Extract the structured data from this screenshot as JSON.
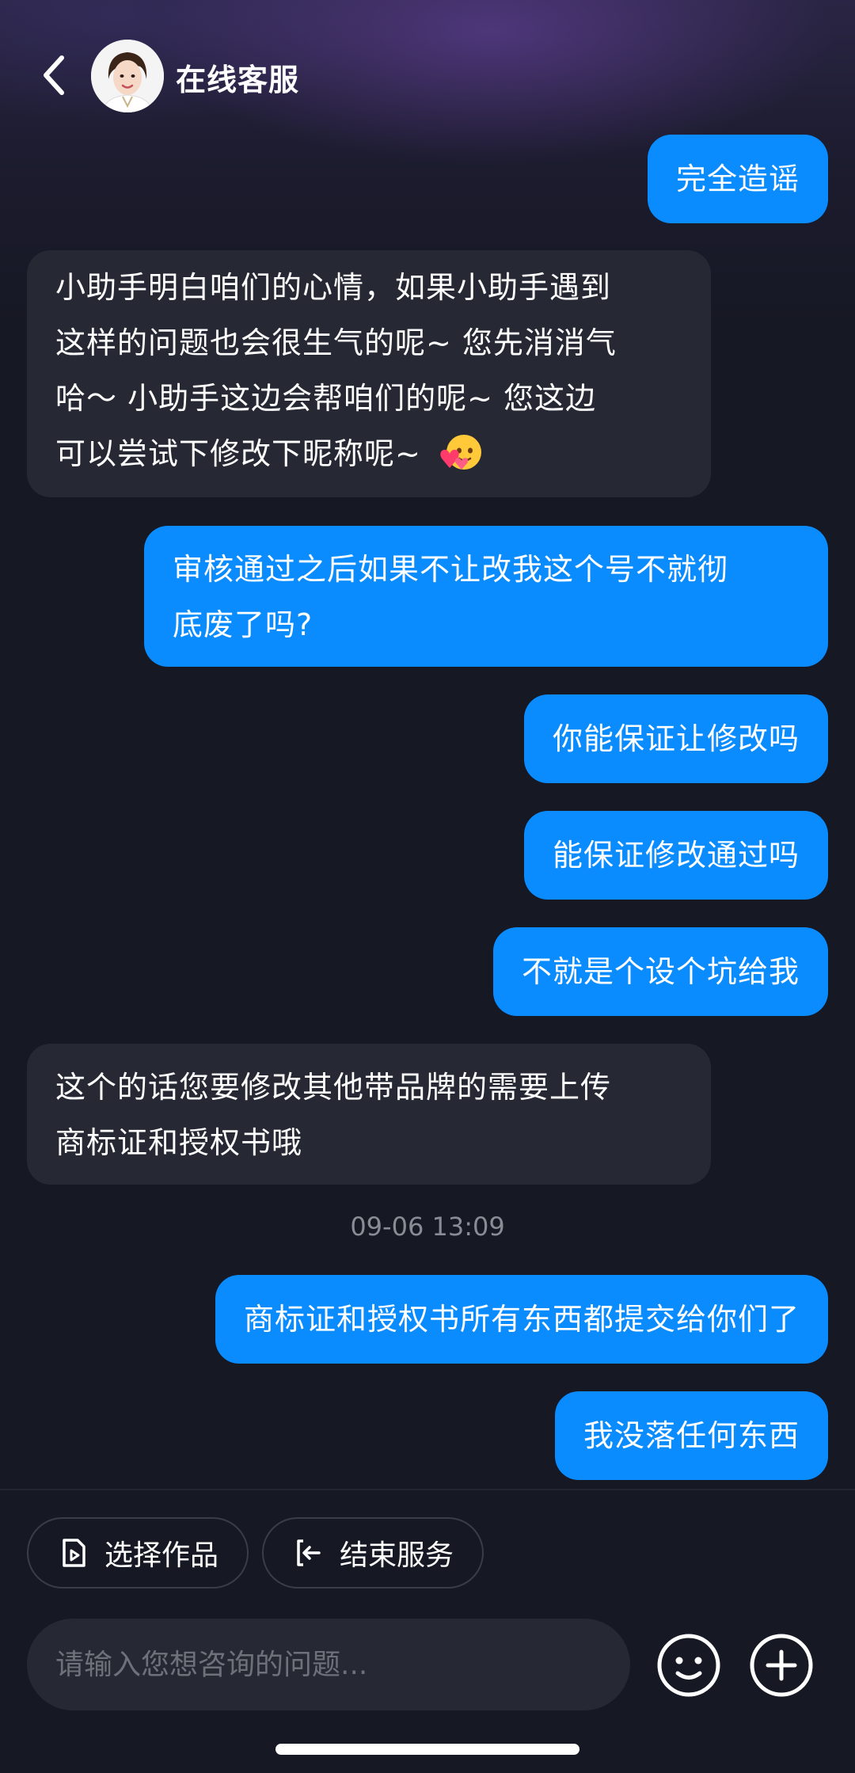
{
  "header": {
    "title": "在线客服",
    "back_icon": "chevron-left-icon",
    "avatar_icon": "agent-avatar"
  },
  "messages": [
    {
      "side": "out",
      "lines": [
        "完全造谣"
      ]
    },
    {
      "side": "in",
      "lines": [
        "小助手明白咱们的心情，如果小助手遇到",
        "这样的问题也会很生气的呢~ 您先消消气",
        "哈～ 小助手这边会帮咱们的呢~ 您这边",
        "可以尝试下修改下昵称呢~"
      ],
      "emoji": "hugging-hearts-emoji"
    },
    {
      "side": "out",
      "lines": [
        "审核通过之后如果不让改我这个号不就彻",
        "底废了吗?"
      ]
    },
    {
      "side": "out",
      "lines": [
        "你能保证让修改吗"
      ]
    },
    {
      "side": "out",
      "lines": [
        "能保证修改通过吗"
      ]
    },
    {
      "side": "out",
      "lines": [
        "不就是个设个坑给我"
      ]
    },
    {
      "side": "in",
      "lines": [
        "这个的话您要修改其他带品牌的需要上传",
        "商标证和授权书哦"
      ]
    },
    {
      "side": "out",
      "lines": [
        "商标证和授权书所有东西都提交给你们了"
      ]
    },
    {
      "side": "out",
      "lines": [
        "我没落任何东西"
      ]
    }
  ],
  "timestamp": "09-06 13:09",
  "quick_actions": [
    {
      "label": "选择作品",
      "icon": "video-file-icon"
    },
    {
      "label": "结束服务",
      "icon": "exit-icon"
    }
  ],
  "input": {
    "placeholder": "请输入您想咨询的问题...",
    "value": ""
  },
  "buttons": {
    "emoji_icon": "smiley-icon",
    "plus_icon": "plus-circle-icon"
  },
  "colors": {
    "background": "#161823",
    "outgoing_bubble": "#0a8cff",
    "incoming_bubble": "#262833"
  }
}
